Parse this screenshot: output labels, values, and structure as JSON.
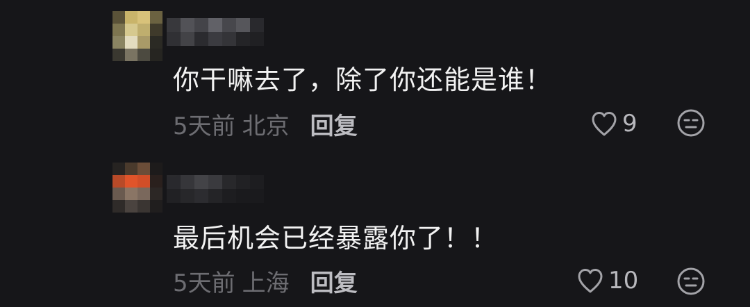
{
  "comments": [
    {
      "text": "你干嘛去了，除了你还能是谁！",
      "time": "5天前",
      "location": "北京",
      "reply_label": "回复",
      "like_count": "9",
      "avatar_colors": [
        "#5a5238",
        "#c9b46a",
        "#d8c27a",
        "#6b6241",
        "#7d7550",
        "#d6c98f",
        "#bfae6e",
        "#3f3a2b",
        "#8a8462",
        "#e3dcc0",
        "#a99a68",
        "#2b2a24",
        "#3a3830",
        "#7a7462",
        "#4c4a40",
        "#262521"
      ],
      "name_colors": [
        "#3c3c40",
        "#59595e",
        "#4a4a4f",
        "#6a6a70",
        "#4d4d52",
        "#5e5e63",
        "#2c2c30",
        "#333337",
        "#48484d",
        "#2e2e32",
        "#404045",
        "#38383c",
        "#262629",
        "#222225"
      ]
    },
    {
      "text": "最后机会已经暴露你了！！",
      "time": "5天前",
      "location": "上海",
      "reply_label": "回复",
      "like_count": "10",
      "avatar_colors": [
        "#262321",
        "#4a3a2c",
        "#6b4d38",
        "#1d1b1b",
        "#b84a28",
        "#e0542a",
        "#d24e28",
        "#2a201d",
        "#6a5a4f",
        "#8a7565",
        "#7a685c",
        "#2c2725",
        "#2f2b29",
        "#4a433f",
        "#3a3532",
        "#201e1e"
      ],
      "name_colors": [
        "#2c2c30",
        "#3a3a3e",
        "#48484c",
        "#3f3f43",
        "#2a2a2e",
        "#232326",
        "#1e1e21",
        "#232326",
        "#29292c",
        "#2f2f33",
        "#262629",
        "#1e1e21",
        "#1b1b1e",
        "#1b1b1e"
      ]
    }
  ]
}
